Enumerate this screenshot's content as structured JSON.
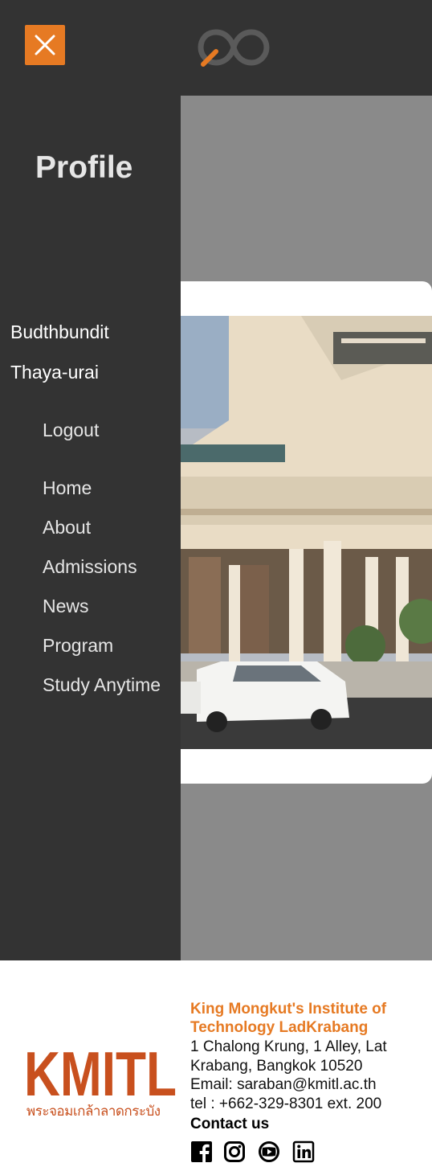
{
  "header": {
    "close_icon": "close-x-icon",
    "logo_icon": "infinity-logo-icon",
    "accent_color": "#e67a23"
  },
  "sidebar": {
    "title": "Profile",
    "user": {
      "first_name": "Budthbundit",
      "last_name": "Thaya-urai"
    },
    "logout_label": "Logout",
    "menu": [
      {
        "label": "Home"
      },
      {
        "label": "About"
      },
      {
        "label": "Admissions"
      },
      {
        "label": "News"
      },
      {
        "label": "Program"
      },
      {
        "label": "Study Anytime"
      }
    ]
  },
  "footer": {
    "logo_text": "KMITL",
    "logo_thai": "พระจอมเกล้าลาดกระบัง",
    "institute_name": "King Mongkut's Institute of Technology LadKrabang",
    "address": "1 Chalong Krung, 1 Alley, Lat Krabang, Bangkok 10520",
    "email": "Email: saraban@kmitl.ac.th",
    "tel": "tel : +662-329-8301 ext. 200",
    "contact_label": "Contact us",
    "social_icons": [
      "facebook-icon",
      "instagram-icon",
      "youtube-icon",
      "linkedin-icon"
    ]
  }
}
